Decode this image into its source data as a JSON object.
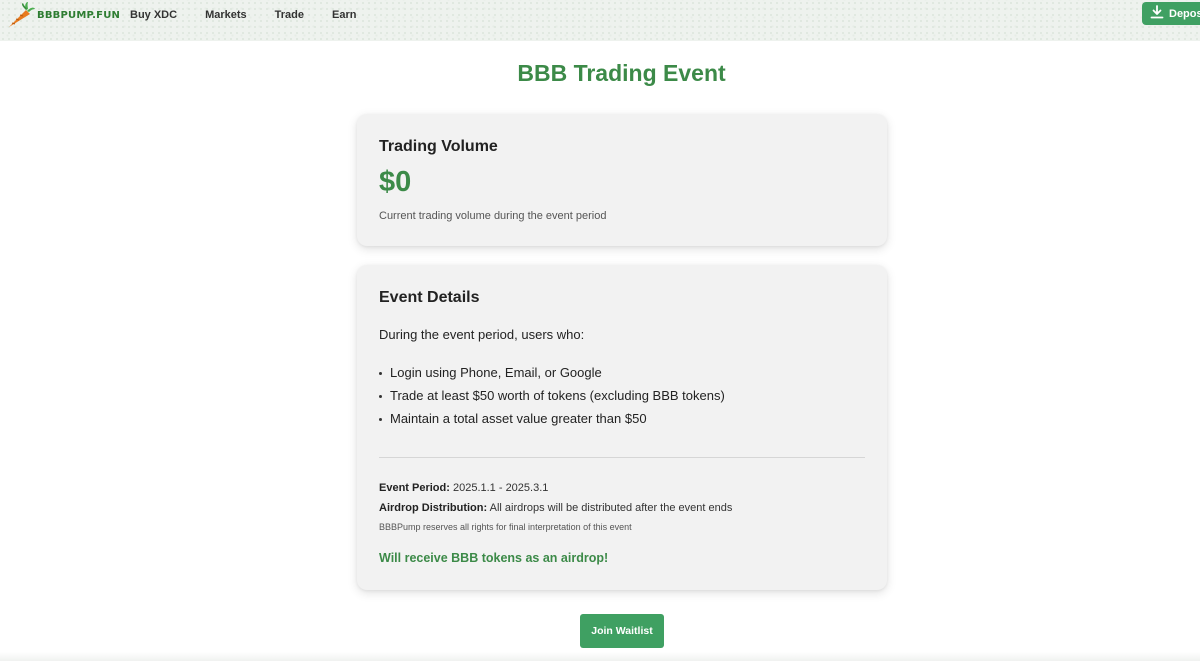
{
  "header": {
    "logo_text": "BBBPUMP.FUN",
    "nav": [
      "Buy XDC",
      "Markets",
      "Trade",
      "Earn"
    ],
    "deposit_label": "Deposit"
  },
  "page": {
    "title": "BBB Trading Event"
  },
  "volume_card": {
    "title": "Trading Volume",
    "value": "$0",
    "subtitle": "Current trading volume during the event period"
  },
  "details_card": {
    "title": "Event Details",
    "intro": "During the event period, users who:",
    "requirements": [
      "Login using Phone, Email, or Google",
      "Trade at least $50 worth of tokens (excluding BBB tokens)",
      "Maintain a total asset value greater than $50"
    ],
    "period_label": "Event Period:",
    "period_value": "2025.1.1 - 2025.3.1",
    "airdrop_label": "Airdrop Distribution:",
    "airdrop_value": "All airdrops will be distributed after the event ends",
    "rights_note": "BBBPump reserves all rights for final interpretation of this event",
    "receive_text": "Will receive BBB tokens as an airdrop!"
  },
  "join_button": "Join Waitlist",
  "colors": {
    "accent_green": "#3c8a48",
    "button_green": "#3fa062"
  },
  "icons": {
    "logo": "carrot-icon",
    "deposit": "download-icon"
  }
}
